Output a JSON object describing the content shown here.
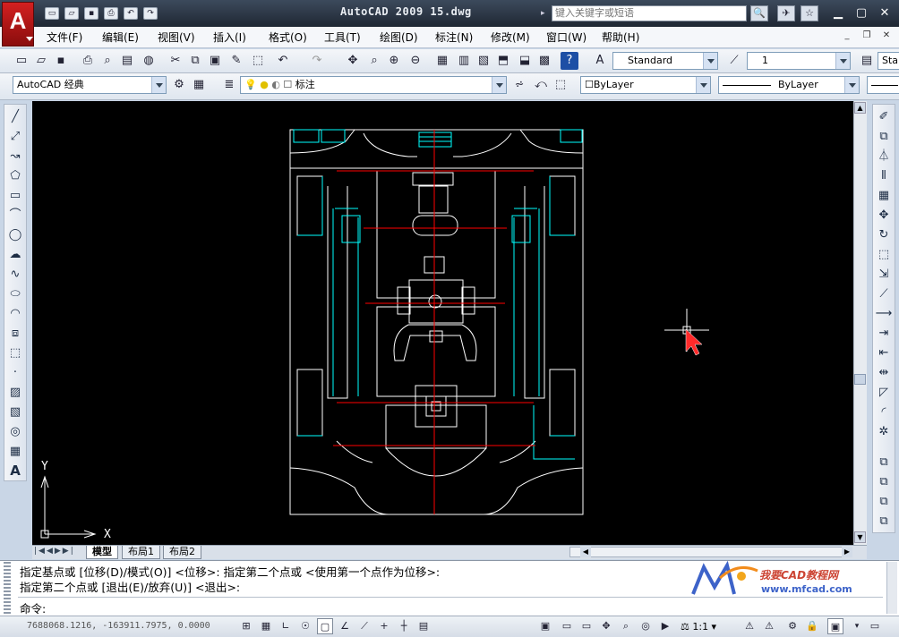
{
  "title_bar": {
    "app_logo_letter": "A",
    "window_title": "AutoCAD 2009  15.dwg",
    "search_placeholder": "键入关键字或短语"
  },
  "menu": [
    "文件(F)",
    "编辑(E)",
    "视图(V)",
    "插入(I)",
    "格式(O)",
    "工具(T)",
    "绘图(D)",
    "标注(N)",
    "修改(M)",
    "窗口(W)",
    "帮助(H)"
  ],
  "toolbar": {
    "text_style": "Standard",
    "dim_scale": "1",
    "dim_style_partial": "Sta"
  },
  "layer_bar": {
    "workspace": "AutoCAD 经典",
    "current_layer": "标注",
    "color": "ByLayer",
    "linetype": "ByLayer"
  },
  "tabs": [
    "模型",
    "布局1",
    "布局2"
  ],
  "ucs": {
    "x_label": "X",
    "y_label": "Y"
  },
  "command": {
    "line1": "指定基点或 [位移(D)/模式(O)] <位移>: 指定第二个点或 <使用第一个点作为位移>:",
    "line2": "指定第二个点或 [退出(E)/放弃(U)] <退出>:",
    "prompt": "命令:"
  },
  "watermark": {
    "name": "我要CAD教程网",
    "url": "www.mfcad.com"
  },
  "status": {
    "coordinates": "7688068.1216, -163911.7975, 0.0000",
    "annotation_scale": "1:1"
  },
  "colors": {
    "canvas": "#000000",
    "plan_lines": "#ffffff",
    "cyan": "#00ffff",
    "red_axis": "#ff0000",
    "cursor": "#ff2a2a"
  }
}
